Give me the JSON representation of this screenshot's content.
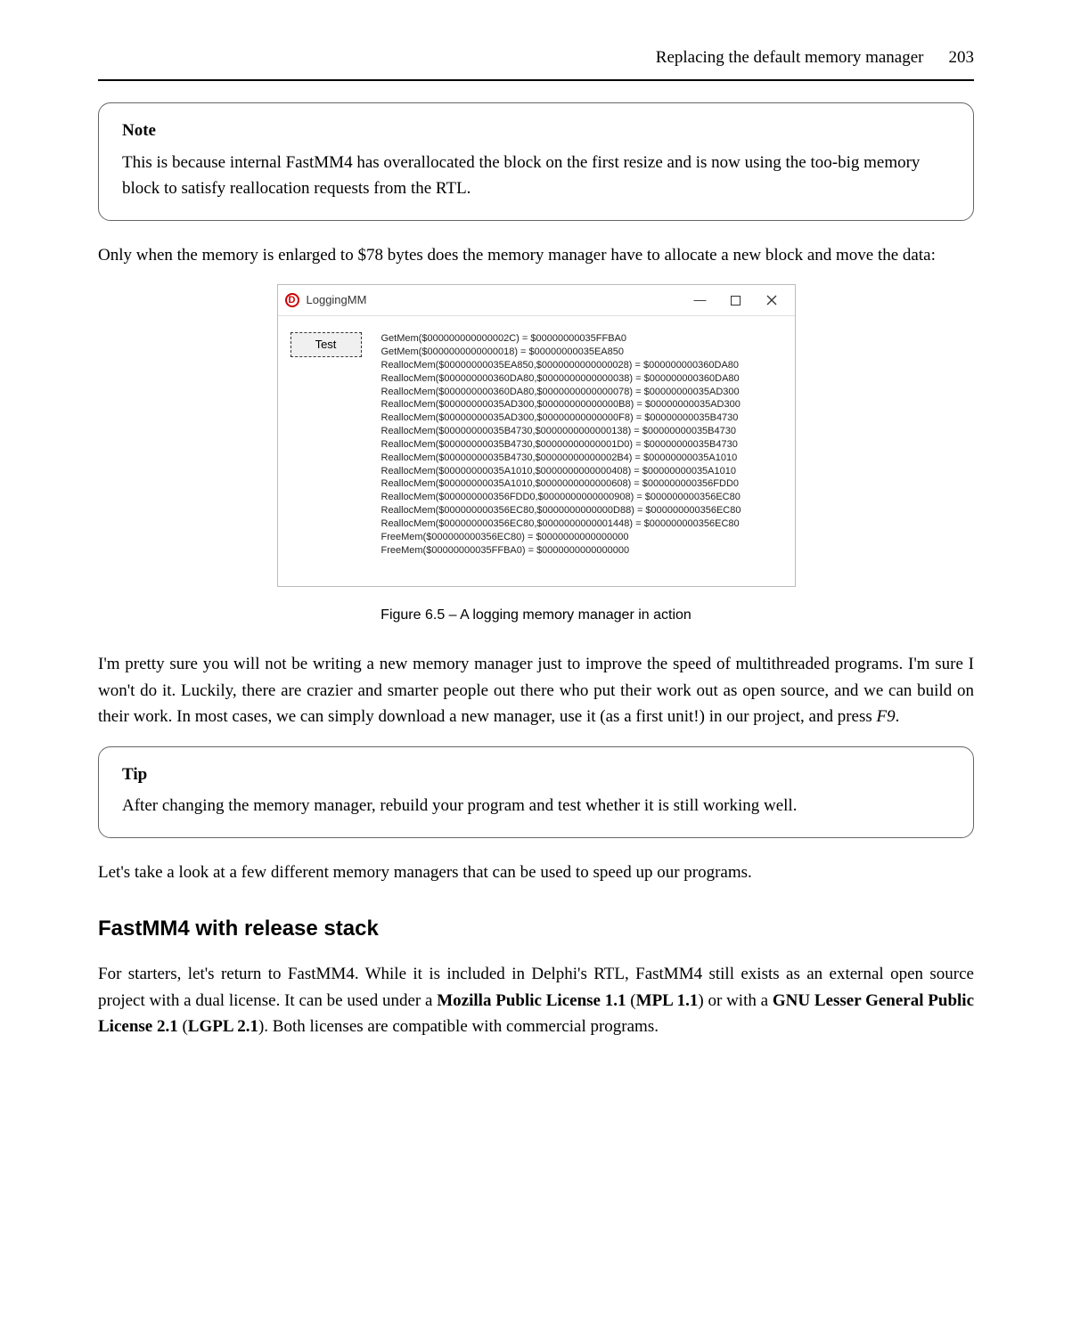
{
  "header": {
    "title": "Replacing the default memory manager",
    "page": "203"
  },
  "note": {
    "label": "Note",
    "body": "This is because internal FastMM4 has overallocated the block on the first resize and is now using the too-big memory block to satisfy reallocation requests from the RTL."
  },
  "para1": "Only when the memory is enlarged to $78 bytes does the memory manager have to allocate a new block and move the data:",
  "window": {
    "icon_letter": "D",
    "title": "LoggingMM",
    "minimize": "—",
    "test_label": "Test",
    "log_lines": [
      "GetMem($000000000000002C) = $00000000035FFBA0",
      "GetMem($0000000000000018) = $00000000035EA850",
      "ReallocMem($00000000035EA850,$0000000000000028) = $000000000360DA80",
      "ReallocMem($000000000360DA80,$0000000000000038) = $000000000360DA80",
      "ReallocMem($000000000360DA80,$0000000000000078) = $00000000035AD300",
      "ReallocMem($00000000035AD300,$00000000000000B8) = $00000000035AD300",
      "ReallocMem($00000000035AD300,$00000000000000F8) = $00000000035B4730",
      "ReallocMem($00000000035B4730,$0000000000000138) = $00000000035B4730",
      "ReallocMem($00000000035B4730,$00000000000001D0) = $00000000035B4730",
      "ReallocMem($00000000035B4730,$00000000000002B4) = $00000000035A1010",
      "ReallocMem($00000000035A1010,$0000000000000408) = $00000000035A1010",
      "ReallocMem($00000000035A1010,$0000000000000608) = $000000000356FDD0",
      "ReallocMem($000000000356FDD0,$0000000000000908) = $000000000356EC80",
      "ReallocMem($000000000356EC80,$0000000000000D88) = $000000000356EC80",
      "ReallocMem($000000000356EC80,$0000000000001448) = $000000000356EC80",
      "FreeMem($000000000356EC80) = $0000000000000000",
      "FreeMem($00000000035FFBA0) = $0000000000000000"
    ]
  },
  "figure_caption": "Figure 6.5 – A logging memory manager in action",
  "para2_a": "I'm pretty sure you will not be writing a new memory manager just to improve the speed of multithreaded programs. I'm sure I won't do it. Luckily, there are crazier and smarter people out there who put their work out as open source, and we can build on their work. In most cases, we can simply download a new manager, use it (as a first unit!) in our project, and press ",
  "para2_key": "F9",
  "para2_b": ".",
  "tip": {
    "label": "Tip",
    "body": "After changing the memory manager, rebuild your program and test whether it is still working well."
  },
  "para3": "Let's take a look at a few different memory managers that can be used to speed up our programs.",
  "section_heading": "FastMM4 with release stack",
  "para4_a": "For starters, let's return to FastMM4. While it is included in Delphi's RTL, FastMM4 still exists as an external open source project with a dual license. It can be used under a ",
  "para4_b1": "Mozilla Public License 1.1",
  "para4_c": " (",
  "para4_b2": "MPL 1.1",
  "para4_d": ") or with a ",
  "para4_b3": "GNU Lesser General Public License 2.1",
  "para4_e": " (",
  "para4_b4": "LGPL 2.1",
  "para4_f": "). Both licenses are compatible with commercial programs."
}
